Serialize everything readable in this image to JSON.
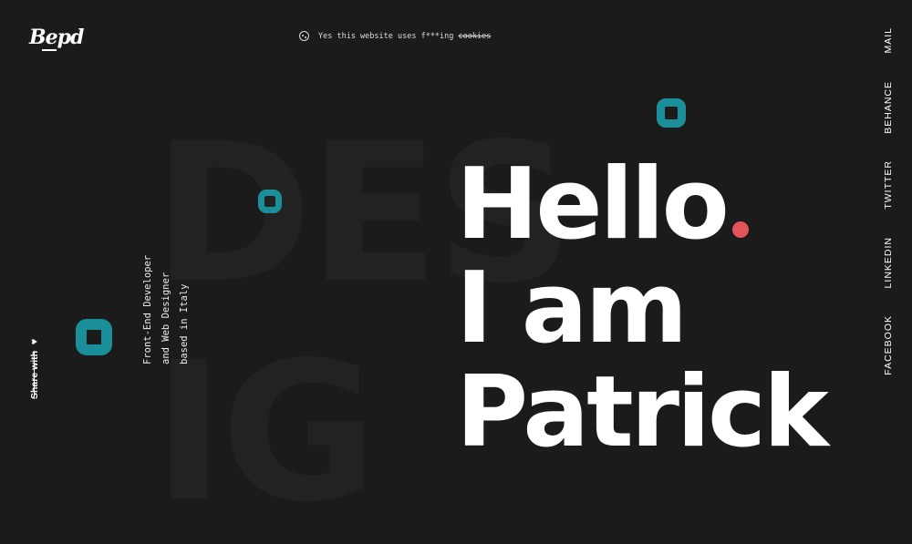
{
  "brand": {
    "logo_text": "Bepd"
  },
  "cookie_notice": {
    "text": "Yes this website uses f***ing ",
    "struck_word": "cookies"
  },
  "social_links": [
    "MAIL",
    "BEHANCE",
    "TWITTER",
    "LINKEDIN",
    "FACEBOOK"
  ],
  "tagline": [
    "Front-End Developer",
    "and Web Designer",
    "based in Italy"
  ],
  "share": {
    "label": "Share with"
  },
  "hero": {
    "line1": "Hello",
    "line2": "I am",
    "line3": "Patrick"
  },
  "background_word": {
    "line1": "DES",
    "line2": "IG"
  },
  "colors": {
    "background": "#1b1b1b",
    "accent_teal": "#1a8f9a",
    "accent_red": "#e2535a"
  }
}
